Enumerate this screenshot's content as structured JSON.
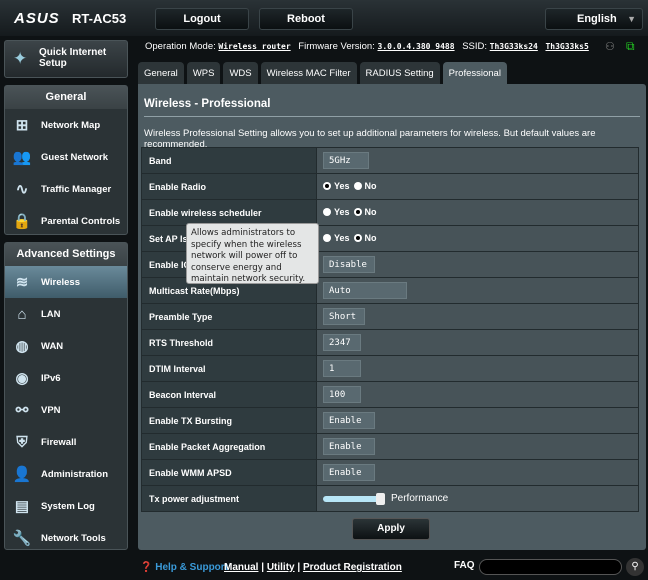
{
  "header": {
    "brand": "ASUS",
    "model": "RT-AC53",
    "logout": "Logout",
    "reboot": "Reboot",
    "language": "English"
  },
  "sidebar": {
    "quick_setup": "Quick Internet Setup",
    "general_title": "General",
    "general": [
      {
        "label": "Network Map",
        "icon": "network-map-icon"
      },
      {
        "label": "Guest Network",
        "icon": "guest-network-icon"
      },
      {
        "label": "Traffic Manager",
        "icon": "traffic-icon"
      },
      {
        "label": "Parental Controls",
        "icon": "parental-icon"
      }
    ],
    "advanced_title": "Advanced Settings",
    "advanced": [
      {
        "label": "Wireless",
        "icon": "wifi-icon",
        "active": true
      },
      {
        "label": "LAN",
        "icon": "home-icon"
      },
      {
        "label": "WAN",
        "icon": "globe-icon"
      },
      {
        "label": "IPv6",
        "icon": "ipv6-icon"
      },
      {
        "label": "VPN",
        "icon": "vpn-icon"
      },
      {
        "label": "Firewall",
        "icon": "shield-icon"
      },
      {
        "label": "Administration",
        "icon": "admin-icon"
      },
      {
        "label": "System Log",
        "icon": "log-icon"
      },
      {
        "label": "Network Tools",
        "icon": "tools-icon"
      }
    ]
  },
  "status": {
    "op_label": "Operation Mode:",
    "op_value": "Wireless router",
    "fw_label": "Firmware Version:",
    "fw_value": "3.0.0.4.380_9488",
    "ssid_label": "SSID:",
    "ssid1": "Th3G33ks24",
    "ssid2": "Th3G33ks5"
  },
  "tabs": [
    "General",
    "WPS",
    "WDS",
    "Wireless MAC Filter",
    "RADIUS Setting",
    "Professional"
  ],
  "main": {
    "title": "Wireless - Professional",
    "description": "Wireless Professional Setting allows you to set up additional parameters for wireless. But default values are recommended.",
    "yes": "Yes",
    "no": "No",
    "rows": [
      {
        "label": "Band",
        "type": "select",
        "value": "5GHz"
      },
      {
        "label": "Enable Radio",
        "type": "radio",
        "value": "Yes"
      },
      {
        "label": "Enable wireless scheduler",
        "type": "radio",
        "value": "No"
      },
      {
        "label": "Set AP Isolated",
        "type": "radio",
        "value": "No"
      },
      {
        "label": "Enable IGMP Snooping",
        "type": "select",
        "value": "Disable"
      },
      {
        "label": "Multicast Rate(Mbps)",
        "type": "select",
        "value": "Auto"
      },
      {
        "label": "Preamble Type",
        "type": "select",
        "value": "Short"
      },
      {
        "label": "RTS Threshold",
        "type": "input",
        "value": "2347"
      },
      {
        "label": "DTIM Interval",
        "type": "input",
        "value": "1"
      },
      {
        "label": "Beacon Interval",
        "type": "input",
        "value": "100"
      },
      {
        "label": "Enable TX Bursting",
        "type": "select",
        "value": "Enable"
      },
      {
        "label": "Enable Packet Aggregation",
        "type": "select",
        "value": "Enable"
      },
      {
        "label": "Enable WMM APSD",
        "type": "select",
        "value": "Enable"
      },
      {
        "label": "Tx power adjustment",
        "type": "slider",
        "value": "Performance",
        "level": 1.0
      }
    ],
    "tooltip": "Allows administrators to specify when the wireless network will power off to conserve energy and maintain network security.",
    "apply": "Apply"
  },
  "footer": {
    "help": "Help & Support",
    "manual": "Manual",
    "utility": "Utility",
    "registration": "Product Registration",
    "faq": "FAQ"
  }
}
